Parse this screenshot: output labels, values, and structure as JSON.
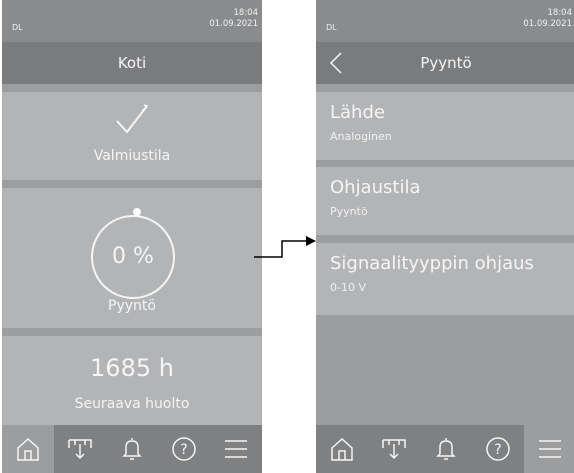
{
  "left_screen": {
    "status": {
      "dl": "DL",
      "time": "18:04",
      "date": "01.09.2021"
    },
    "title": "Koti",
    "tiles": {
      "standby": {
        "label": "Valmiustila",
        "icon": "checkmark-icon"
      },
      "demand": {
        "value": "0 %",
        "label": "Pyyntö",
        "level_percent": 0
      },
      "service": {
        "value": "1685 h",
        "label": "Seuraava huolto"
      }
    }
  },
  "right_screen": {
    "status": {
      "dl": "DL",
      "time": "18:04",
      "date": "01.09.2021"
    },
    "title": "Pyyntö",
    "items": [
      {
        "title": "Lähde",
        "value": "Analoginen"
      },
      {
        "title": "Ohjaustila",
        "value": "Pyyntö"
      },
      {
        "title": "Signaalityyppin ohjaus",
        "value": "0-10 V"
      }
    ]
  },
  "nav": {
    "items": [
      "home-icon",
      "humidifier-icon",
      "bell-icon",
      "help-icon",
      "menu-icon"
    ],
    "left_active": "home-icon",
    "right_active": "menu-icon"
  },
  "colors": {
    "background": "#9c9d9f",
    "tile": "#b3b4b6",
    "status_bar": "#8a8b8d",
    "title_bar": "#7a7b7d",
    "nav_bar": "#7f8082",
    "text": "#f5f5f5"
  }
}
